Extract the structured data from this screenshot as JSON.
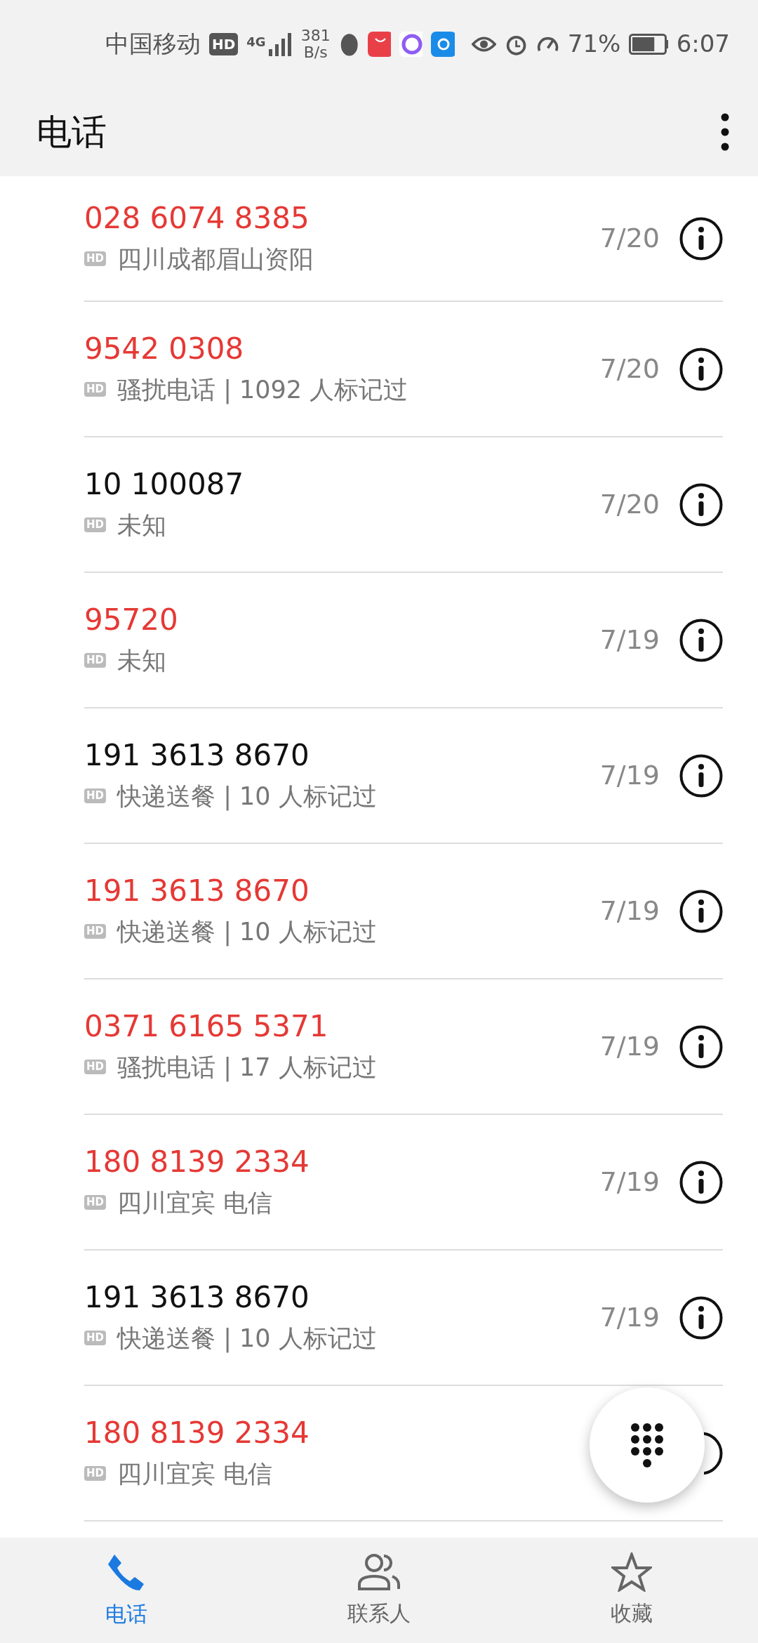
{
  "status_bar": {
    "carrier": "中国移动",
    "hd": "HD",
    "network": "4G",
    "speed_value": "381",
    "speed_unit": "B/s",
    "battery": {
      "text": "71%",
      "level": 0.71
    },
    "time": "6:07"
  },
  "header": {
    "title": "电话"
  },
  "calls": [
    {
      "number": "028 6074 8385",
      "missed": true,
      "hd": "HD",
      "detail": "四川成都眉山资阳",
      "date": "7/20"
    },
    {
      "number": "9542 0308",
      "missed": true,
      "hd": "HD",
      "detail": "骚扰电话 | 1092 人标记过",
      "date": "7/20"
    },
    {
      "number": "10 100087",
      "missed": false,
      "hd": "HD",
      "detail": "未知",
      "date": "7/20"
    },
    {
      "number": "95720",
      "missed": true,
      "hd": "HD",
      "detail": "未知",
      "date": "7/19"
    },
    {
      "number": "191 3613 8670",
      "missed": false,
      "hd": "HD",
      "detail": "快递送餐 | 10 人标记过",
      "date": "7/19"
    },
    {
      "number": "191 3613 8670",
      "missed": true,
      "hd": "HD",
      "detail": "快递送餐 | 10 人标记过",
      "date": "7/19"
    },
    {
      "number": "0371 6165 5371",
      "missed": true,
      "hd": "HD",
      "detail": "骚扰电话 | 17 人标记过",
      "date": "7/19"
    },
    {
      "number": "180 8139 2334",
      "missed": true,
      "hd": "HD",
      "detail": "四川宜宾 电信",
      "date": "7/19"
    },
    {
      "number": "191 3613 8670",
      "missed": false,
      "hd": "HD",
      "detail": "快递送餐 | 10 人标记过",
      "date": "7/19"
    },
    {
      "number": "180 8139 2334",
      "missed": true,
      "hd": "HD",
      "detail": "四川宜宾 电信"
    }
  ],
  "tabs": [
    {
      "label": "电话",
      "kind": "phone",
      "selected": true
    },
    {
      "label": "联系人",
      "kind": "contacts",
      "selected": false
    },
    {
      "label": "收藏",
      "kind": "star",
      "selected": false
    }
  ]
}
